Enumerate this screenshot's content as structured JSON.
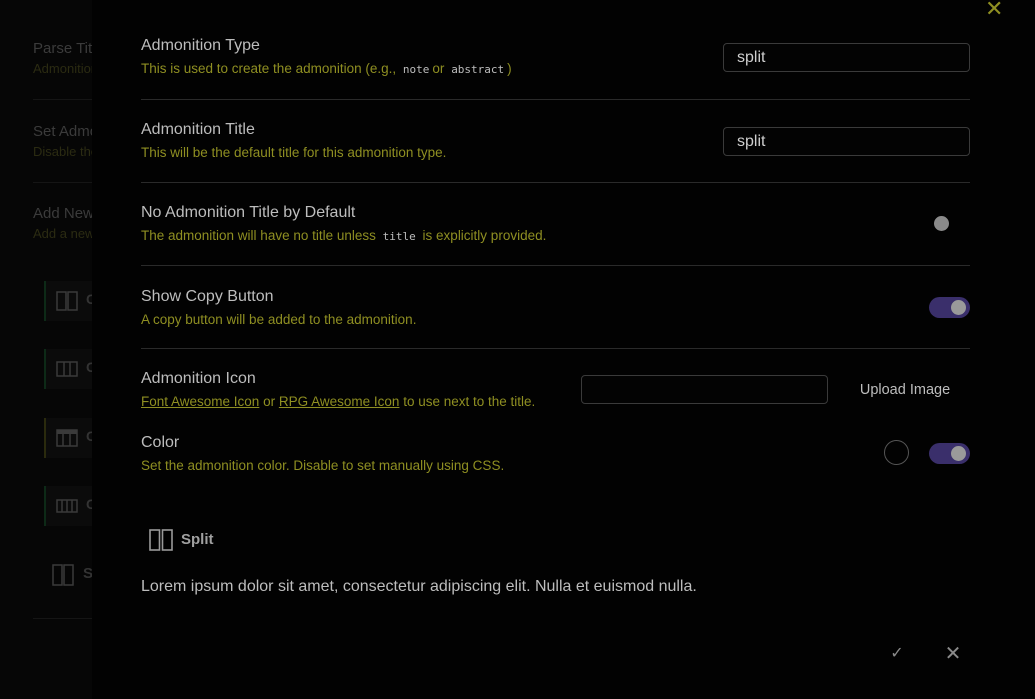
{
  "background": {
    "settings": [
      {
        "title": "Parse Titles",
        "desc": "Admonition"
      },
      {
        "title": "Set Admonition",
        "desc": "Disable the"
      },
      {
        "title": "Add New",
        "desc": "Add a new"
      }
    ],
    "items": [
      "C",
      "C",
      "C",
      "C"
    ],
    "plain_item": "S"
  },
  "modal": {
    "type": {
      "name": "Admonition Type",
      "desc_before": "This is used to create the admonition (e.g.,",
      "code_1": "note",
      "desc_or": "or",
      "code_2": "abstract",
      "desc_after": ")",
      "value": "split"
    },
    "title": {
      "name": "Admonition Title",
      "desc": "This will be the default title for this admonition type.",
      "value": "split"
    },
    "no_title": {
      "name": "No Admonition Title by Default",
      "desc_before": "The admonition will have no title unless",
      "code": "title",
      "desc_after": "is explicitly provided.",
      "enabled": false
    },
    "copy": {
      "name": "Show Copy Button",
      "desc": "A copy button will be added to the admonition.",
      "enabled": true
    },
    "icon": {
      "name": "Admonition Icon",
      "link_1": "Font Awesome Icon",
      "or": "or",
      "link_2": "RPG Awesome Icon",
      "desc_after": "to use next to the title.",
      "value": "",
      "upload_label": "Upload Image"
    },
    "color": {
      "name": "Color",
      "desc": "Set the admonition color. Disable to set manually using CSS.",
      "enabled": true
    },
    "preview": {
      "title": "Split",
      "body": "Lorem ipsum dolor sit amet, consectetur adipiscing elit. Nulla et euismod nulla."
    },
    "buttons": {
      "confirm": "✓",
      "cancel": "✕",
      "close": "✕"
    }
  },
  "colors": {
    "accent_text": "#8f8f22",
    "toggle_on": "#3a2f6b"
  }
}
